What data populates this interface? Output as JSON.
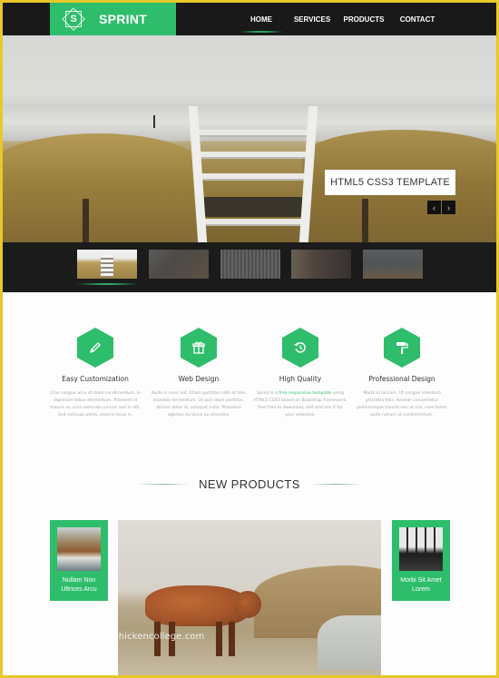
{
  "theme": {
    "accent": "#2ebd6b",
    "header_bg": "#1a1919",
    "frame": "#e8c82a"
  },
  "brand": {
    "logo_letter": "S",
    "name": "SPRINT"
  },
  "nav": {
    "items": [
      {
        "label": "HOME",
        "active": true
      },
      {
        "label": "SERVICES",
        "active": false
      },
      {
        "label": "PRODUCTS",
        "active": false
      },
      {
        "label": "CONTACT",
        "active": false
      }
    ]
  },
  "hero": {
    "caption": "HTML5 CSS3 TEMPLATE",
    "prev_icon": "chevron-left-icon",
    "next_icon": "chevron-right-icon",
    "prev_glyph": "‹",
    "next_glyph": "›"
  },
  "thumbnails": {
    "count": 5,
    "active_index": 0
  },
  "features": [
    {
      "icon": "pencil-icon",
      "title": "Easy Customization",
      "text": "Cras congue arcu at diam condimentum, in dignissim tellus elementum. Praesent id mauris eu urna vehicula cursum sed in elit. Sed vehicula porta, viverra lacus in."
    },
    {
      "icon": "gift-icon",
      "title": "Web Design",
      "text": "Nulla in nunc elit. Etiam porttitor nibh et felis molestie fermentum. Ut quis diam porttitor, dictum dolor id, volutpat nulla. Phasellus egestas eu lacus eu pharetra."
    },
    {
      "icon": "history-icon",
      "title": "High Quality",
      "text_before": "Sprint is a ",
      "text_link": "free responsive template",
      "text_after": " using HTML5 CSS3 based on Bootstrap framework. Feel free to download, edit and use it for your websites."
    },
    {
      "icon": "paint-roller-icon",
      "title": "Professional Design",
      "text": "Morbi in lacinim. Ut congue interdum pharetra felis. Aenean consectetur pellentesque mauris nec ut nisl, nam tortor justo rutrum ut condimentum."
    }
  ],
  "new_products": {
    "heading": "NEW PRODUCTS",
    "left_card": {
      "name_line1": "Nullam Non",
      "name_line2": "Ultrices Arcu"
    },
    "right_card": {
      "name_line1": "Morbi Sit Amet",
      "name_line2": "Lorem"
    }
  },
  "watermark": "www.theeggandchickencollege.com"
}
